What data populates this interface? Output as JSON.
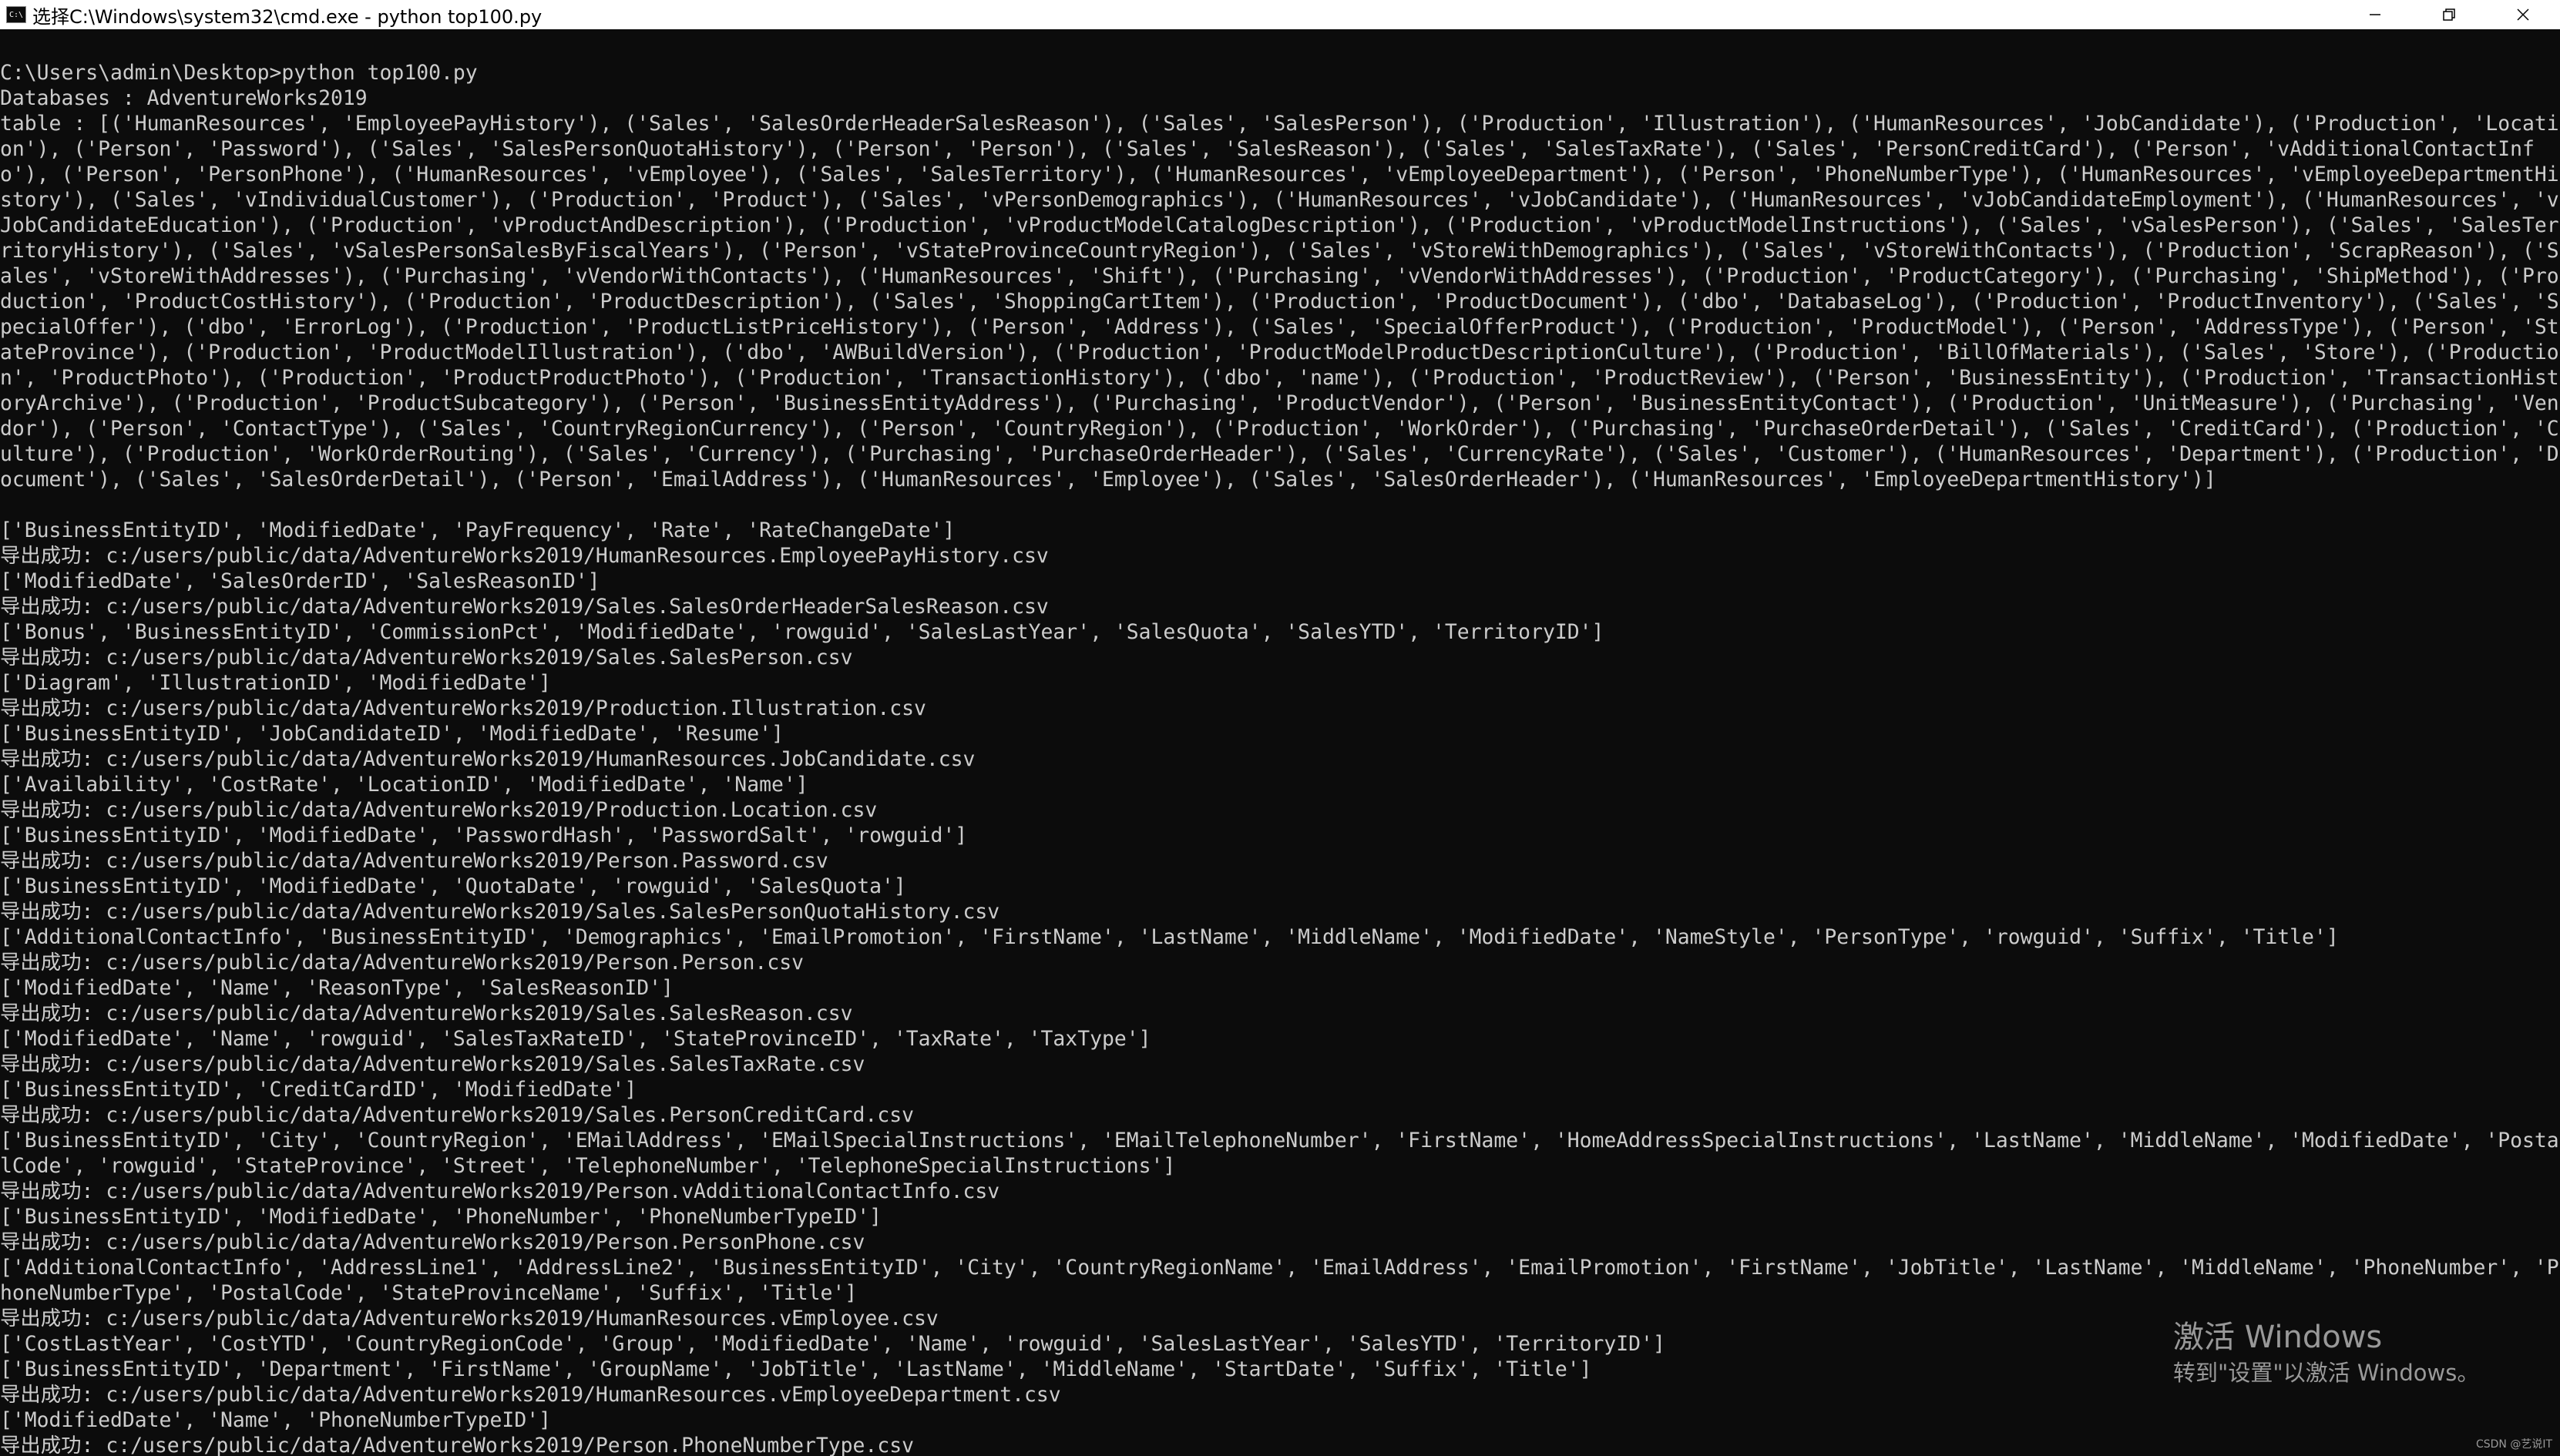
{
  "window": {
    "title": "选择C:\\Windows\\system32\\cmd.exe - python  top100.py",
    "app_icon_text": "C:\\",
    "controls": [
      "minimize-icon",
      "restore-icon",
      "close-icon"
    ]
  },
  "console": {
    "lines": [
      "C:\\Users\\admin\\Desktop>python top100.py",
      "Databases : AdventureWorks2019",
      "table : [('HumanResources', 'EmployeePayHistory'), ('Sales', 'SalesOrderHeaderSalesReason'), ('Sales', 'SalesPerson'), ('Production', 'Illustration'), ('HumanResources', 'JobCandidate'), ('Production', 'Location'), ('Person', 'Password'), ('Sales', 'SalesPersonQuotaHistory'), ('Person', 'Person'), ('Sales', 'SalesReason'), ('Sales', 'SalesTaxRate'), ('Sales', 'PersonCreditCard'), ('Person', 'vAdditionalContactInfo'), ('Person', 'PersonPhone'), ('HumanResources', 'vEmployee'), ('Sales', 'SalesTerritory'), ('HumanResources', 'vEmployeeDepartment'), ('Person', 'PhoneNumberType'), ('HumanResources', 'vEmployeeDepartmentHistory'), ('Sales', 'vIndividualCustomer'), ('Production', 'Product'), ('Sales', 'vPersonDemographics'), ('HumanResources', 'vJobCandidate'), ('HumanResources', 'vJobCandidateEmployment'), ('HumanResources', 'vJobCandidateEducation'), ('Production', 'vProductAndDescription'), ('Production', 'vProductModelCatalogDescription'), ('Production', 'vProductModelInstructions'), ('Sales', 'vSalesPerson'), ('Sales', 'SalesTerritoryHistory'), ('Sales', 'vSalesPersonSalesByFiscalYears'), ('Person', 'vStateProvinceCountryRegion'), ('Sales', 'vStoreWithDemographics'), ('Sales', 'vStoreWithContacts'), ('Production', 'ScrapReason'), ('Sales', 'vStoreWithAddresses'), ('Purchasing', 'vVendorWithContacts'), ('HumanResources', 'Shift'), ('Purchasing', 'vVendorWithAddresses'), ('Production', 'ProductCategory'), ('Purchasing', 'ShipMethod'), ('Production', 'ProductCostHistory'), ('Production', 'ProductDescription'), ('Sales', 'ShoppingCartItem'), ('Production', 'ProductDocument'), ('dbo', 'DatabaseLog'), ('Production', 'ProductInventory'), ('Sales', 'SpecialOffer'), ('dbo', 'ErrorLog'), ('Production', 'ProductListPriceHistory'), ('Person', 'Address'), ('Sales', 'SpecialOfferProduct'), ('Production', 'ProductModel'), ('Person', 'AddressType'), ('Person', 'StateProvince'), ('Production', 'ProductModelIllustration'), ('dbo', 'AWBuildVersion'), ('Production', 'ProductModelProductDescriptionCulture'), ('Production', 'BillOfMaterials'), ('Sales', 'Store'), ('Production', 'ProductPhoto'), ('Production', 'ProductProductPhoto'), ('Production', 'TransactionHistory'), ('dbo', 'name'), ('Production', 'ProductReview'), ('Person', 'BusinessEntity'), ('Production', 'TransactionHistoryArchive'), ('Production', 'ProductSubcategory'), ('Person', 'BusinessEntityAddress'), ('Purchasing', 'ProductVendor'), ('Person', 'BusinessEntityContact'), ('Production', 'UnitMeasure'), ('Purchasing', 'Vendor'), ('Person', 'ContactType'), ('Sales', 'CountryRegionCurrency'), ('Person', 'CountryRegion'), ('Production', 'WorkOrder'), ('Purchasing', 'PurchaseOrderDetail'), ('Sales', 'CreditCard'), ('Production', 'Culture'), ('Production', 'WorkOrderRouting'), ('Sales', 'Currency'), ('Purchasing', 'PurchaseOrderHeader'), ('Sales', 'CurrencyRate'), ('Sales', 'Customer'), ('HumanResources', 'Department'), ('Production', 'Document'), ('Sales', 'SalesOrderDetail'), ('Person', 'EmailAddress'), ('HumanResources', 'Employee'), ('Sales', 'SalesOrderHeader'), ('HumanResources', 'EmployeeDepartmentHistory')]",
      "",
      "['BusinessEntityID', 'ModifiedDate', 'PayFrequency', 'Rate', 'RateChangeDate']",
      "导出成功: c:/users/public/data/AdventureWorks2019/HumanResources.EmployeePayHistory.csv",
      "['ModifiedDate', 'SalesOrderID', 'SalesReasonID']",
      "导出成功: c:/users/public/data/AdventureWorks2019/Sales.SalesOrderHeaderSalesReason.csv",
      "['Bonus', 'BusinessEntityID', 'CommissionPct', 'ModifiedDate', 'rowguid', 'SalesLastYear', 'SalesQuota', 'SalesYTD', 'TerritoryID']",
      "导出成功: c:/users/public/data/AdventureWorks2019/Sales.SalesPerson.csv",
      "['Diagram', 'IllustrationID', 'ModifiedDate']",
      "导出成功: c:/users/public/data/AdventureWorks2019/Production.Illustration.csv",
      "['BusinessEntityID', 'JobCandidateID', 'ModifiedDate', 'Resume']",
      "导出成功: c:/users/public/data/AdventureWorks2019/HumanResources.JobCandidate.csv",
      "['Availability', 'CostRate', 'LocationID', 'ModifiedDate', 'Name']",
      "导出成功: c:/users/public/data/AdventureWorks2019/Production.Location.csv",
      "['BusinessEntityID', 'ModifiedDate', 'PasswordHash', 'PasswordSalt', 'rowguid']",
      "导出成功: c:/users/public/data/AdventureWorks2019/Person.Password.csv",
      "['BusinessEntityID', 'ModifiedDate', 'QuotaDate', 'rowguid', 'SalesQuota']",
      "导出成功: c:/users/public/data/AdventureWorks2019/Sales.SalesPersonQuotaHistory.csv",
      "['AdditionalContactInfo', 'BusinessEntityID', 'Demographics', 'EmailPromotion', 'FirstName', 'LastName', 'MiddleName', 'ModifiedDate', 'NameStyle', 'PersonType', 'rowguid', 'Suffix', 'Title']",
      "导出成功: c:/users/public/data/AdventureWorks2019/Person.Person.csv",
      "['ModifiedDate', 'Name', 'ReasonType', 'SalesReasonID']",
      "导出成功: c:/users/public/data/AdventureWorks2019/Sales.SalesReason.csv",
      "['ModifiedDate', 'Name', 'rowguid', 'SalesTaxRateID', 'StateProvinceID', 'TaxRate', 'TaxType']",
      "导出成功: c:/users/public/data/AdventureWorks2019/Sales.SalesTaxRate.csv",
      "['BusinessEntityID', 'CreditCardID', 'ModifiedDate']",
      "导出成功: c:/users/public/data/AdventureWorks2019/Sales.PersonCreditCard.csv",
      "['BusinessEntityID', 'City', 'CountryRegion', 'EMailAddress', 'EMailSpecialInstructions', 'EMailTelephoneNumber', 'FirstName', 'HomeAddressSpecialInstructions', 'LastName', 'MiddleName', 'ModifiedDate', 'PostalCode', 'rowguid', 'StateProvince', 'Street', 'TelephoneNumber', 'TelephoneSpecialInstructions']",
      "导出成功: c:/users/public/data/AdventureWorks2019/Person.vAdditionalContactInfo.csv",
      "['BusinessEntityID', 'ModifiedDate', 'PhoneNumber', 'PhoneNumberTypeID']",
      "导出成功: c:/users/public/data/AdventureWorks2019/Person.PersonPhone.csv",
      "['AdditionalContactInfo', 'AddressLine1', 'AddressLine2', 'BusinessEntityID', 'City', 'CountryRegionName', 'EmailAddress', 'EmailPromotion', 'FirstName', 'JobTitle', 'LastName', 'MiddleName', 'PhoneNumber', 'PhoneNumberType', 'PostalCode', 'StateProvinceName', 'Suffix', 'Title']",
      "导出成功: c:/users/public/data/AdventureWorks2019/HumanResources.vEmployee.csv",
      "['CostLastYear', 'CostYTD', 'CountryRegionCode', 'Group', 'ModifiedDate', 'Name', 'rowguid', 'SalesLastYear', 'SalesYTD', 'TerritoryID']",
      "['BusinessEntityID', 'Department', 'FirstName', 'GroupName', 'JobTitle', 'LastName', 'MiddleName', 'StartDate', 'Suffix', 'Title']",
      "导出成功: c:/users/public/data/AdventureWorks2019/HumanResources.vEmployeeDepartment.csv",
      "['ModifiedDate', 'Name', 'PhoneNumberTypeID']",
      "导出成功: c:/users/public/data/AdventureWorks2019/Person.PhoneNumberType.csv"
    ]
  },
  "watermark": {
    "title": "激活 Windows",
    "subtitle": "转到\"设置\"以激活 Windows。"
  },
  "credit": "CSDN @艺说IT"
}
